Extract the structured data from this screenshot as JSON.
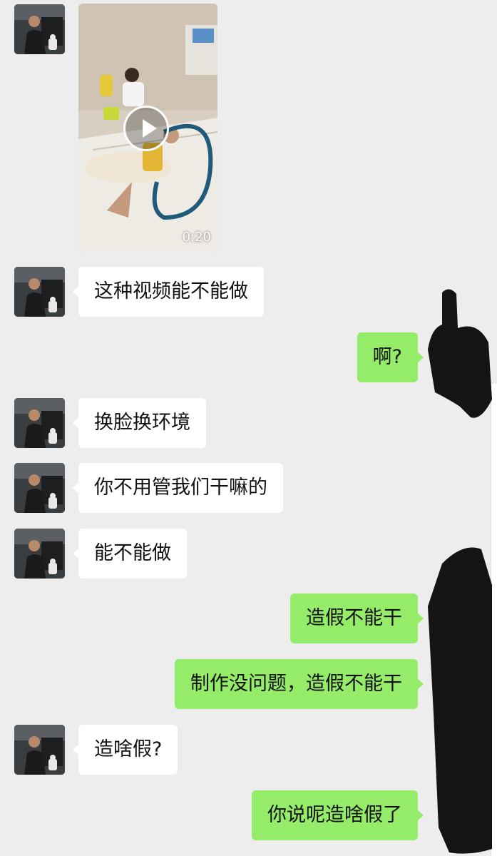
{
  "colors": {
    "background": "#ededed",
    "incoming_bubble": "#ffffff",
    "outgoing_bubble": "#95ec69",
    "redaction": "#141414"
  },
  "contact": {
    "avatar_icon": "contact-avatar"
  },
  "video": {
    "duration": "0:20",
    "play_icon": "play-icon"
  },
  "messages": [
    {
      "side": "in",
      "text": "这种视频能不能做"
    },
    {
      "side": "out",
      "text": "啊?"
    },
    {
      "side": "in",
      "text": "换脸换环境"
    },
    {
      "side": "in",
      "text": "你不用管我们干嘛的"
    },
    {
      "side": "in",
      "text": "能不能做"
    },
    {
      "side": "out",
      "text": "造假不能干"
    },
    {
      "side": "out",
      "text": "制作没问题，造假不能干"
    },
    {
      "side": "in",
      "text": "造啥假?"
    },
    {
      "side": "out",
      "text": "你说呢造啥假了"
    }
  ]
}
